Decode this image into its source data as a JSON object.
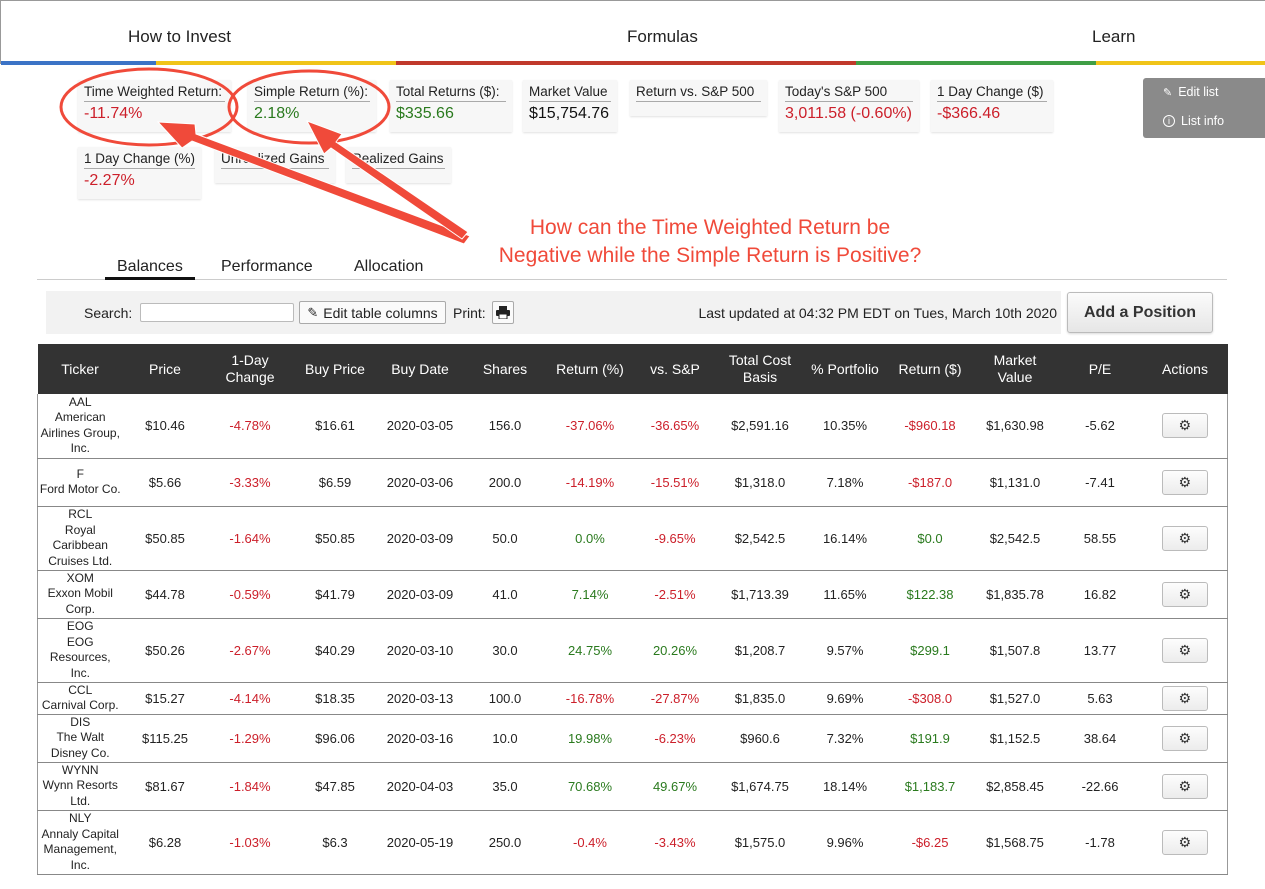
{
  "nav": {
    "items": [
      "How to Invest",
      "Formulas",
      "Learn"
    ],
    "stripe_colors": [
      "#3b73c6",
      "#f0c419",
      "#c0392b",
      "#3f9e45",
      "#f0c419"
    ]
  },
  "stats": [
    {
      "label": "Time Weighted Return:",
      "value": "-11.74%",
      "tone": "neg"
    },
    {
      "label": "Simple Return (%):",
      "value": "2.18%",
      "tone": "pos"
    },
    {
      "label": "Total Returns ($):",
      "value": "$335.66",
      "tone": "pos"
    },
    {
      "label": "Market Value",
      "value": "$15,754.76",
      "tone": "blk"
    },
    {
      "label": "Return vs. S&P 500",
      "value": "",
      "tone": "blk"
    },
    {
      "label": "Today's S&P 500",
      "value": "3,011.58 (-0.60%)",
      "tone": "neg"
    },
    {
      "label": "1 Day Change ($)",
      "value": "-$366.46",
      "tone": "neg"
    },
    {
      "label": "1 Day Change (%)",
      "value": "-2.27%",
      "tone": "neg"
    },
    {
      "label": "Unrealized Gains",
      "value": "",
      "tone": "blk"
    },
    {
      "label": "Realized Gains",
      "value": "",
      "tone": "blk"
    }
  ],
  "sidepanel": {
    "edit_list": "Edit list",
    "list_info": "List info"
  },
  "annotation": {
    "line1": "How can the Time Weighted Return be",
    "line2": "Negative while the Simple Return is Positive?",
    "color": "#f04a3a"
  },
  "tabs": [
    "Balances",
    "Performance",
    "Allocation"
  ],
  "toolbar": {
    "search_label": "Search:",
    "search_value": "",
    "edit_columns_label": "Edit table columns",
    "print_label": "Print:",
    "last_updated": "Last updated at 04:32 PM EDT on Tues, March 10th 2020",
    "add_position_label": "Add a Position"
  },
  "table": {
    "headers": [
      "Ticker",
      "Price",
      "1-Day Change",
      "Buy Price",
      "Buy Date",
      "Shares",
      "Return (%)",
      "vs. S&P",
      "Total Cost Basis",
      "% Portfolio",
      "Return ($)",
      "Market Value",
      "P/E",
      "Actions"
    ],
    "rows": [
      {
        "ticker": "AAL",
        "name": "American Airlines Group, Inc.",
        "price": "$10.46",
        "change": "-4.78%",
        "buy_price": "$16.61",
        "buy_date": "2020-03-05",
        "shares": "156.0",
        "return_pct": "-37.06%",
        "vs_sp": "-36.65%",
        "cost_basis": "$2,591.16",
        "portfolio_pct": "10.35%",
        "return_usd": "-$960.18",
        "market_value": "$1,630.98",
        "pe": "-5.62"
      },
      {
        "ticker": "F",
        "name": "Ford Motor Co.",
        "price": "$5.66",
        "change": "-3.33%",
        "buy_price": "$6.59",
        "buy_date": "2020-03-06",
        "shares": "200.0",
        "return_pct": "-14.19%",
        "vs_sp": "-15.51%",
        "cost_basis": "$1,318.0",
        "portfolio_pct": "7.18%",
        "return_usd": "-$187.0",
        "market_value": "$1,131.0",
        "pe": "-7.41"
      },
      {
        "ticker": "RCL",
        "name": "Royal Caribbean Cruises Ltd.",
        "price": "$50.85",
        "change": "-1.64%",
        "buy_price": "$50.85",
        "buy_date": "2020-03-09",
        "shares": "50.0",
        "return_pct": "0.0%",
        "vs_sp": "-9.65%",
        "cost_basis": "$2,542.5",
        "portfolio_pct": "16.14%",
        "return_usd": "$0.0",
        "market_value": "$2,542.5",
        "pe": "58.55"
      },
      {
        "ticker": "XOM",
        "name": "Exxon Mobil Corp.",
        "price": "$44.78",
        "change": "-0.59%",
        "buy_price": "$41.79",
        "buy_date": "2020-03-09",
        "shares": "41.0",
        "return_pct": "7.14%",
        "vs_sp": "-2.51%",
        "cost_basis": "$1,713.39",
        "portfolio_pct": "11.65%",
        "return_usd": "$122.38",
        "market_value": "$1,835.78",
        "pe": "16.82"
      },
      {
        "ticker": "EOG",
        "name": "EOG Resources, Inc.",
        "price": "$50.26",
        "change": "-2.67%",
        "buy_price": "$40.29",
        "buy_date": "2020-03-10",
        "shares": "30.0",
        "return_pct": "24.75%",
        "vs_sp": "20.26%",
        "cost_basis": "$1,208.7",
        "portfolio_pct": "9.57%",
        "return_usd": "$299.1",
        "market_value": "$1,507.8",
        "pe": "13.77"
      },
      {
        "ticker": "CCL",
        "name": "Carnival Corp.",
        "price": "$15.27",
        "change": "-4.14%",
        "buy_price": "$18.35",
        "buy_date": "2020-03-13",
        "shares": "100.0",
        "return_pct": "-16.78%",
        "vs_sp": "-27.87%",
        "cost_basis": "$1,835.0",
        "portfolio_pct": "9.69%",
        "return_usd": "-$308.0",
        "market_value": "$1,527.0",
        "pe": "5.63"
      },
      {
        "ticker": "DIS",
        "name": "The Walt Disney Co.",
        "price": "$115.25",
        "change": "-1.29%",
        "buy_price": "$96.06",
        "buy_date": "2020-03-16",
        "shares": "10.0",
        "return_pct": "19.98%",
        "vs_sp": "-6.23%",
        "cost_basis": "$960.6",
        "portfolio_pct": "7.32%",
        "return_usd": "$191.9",
        "market_value": "$1,152.5",
        "pe": "38.64"
      },
      {
        "ticker": "WYNN",
        "name": "Wynn Resorts Ltd.",
        "price": "$81.67",
        "change": "-1.84%",
        "buy_price": "$47.85",
        "buy_date": "2020-04-03",
        "shares": "35.0",
        "return_pct": "70.68%",
        "vs_sp": "49.67%",
        "cost_basis": "$1,674.75",
        "portfolio_pct": "18.14%",
        "return_usd": "$1,183.7",
        "market_value": "$2,858.45",
        "pe": "-22.66"
      },
      {
        "ticker": "NLY",
        "name": "Annaly Capital Management, Inc.",
        "price": "$6.28",
        "change": "-1.03%",
        "buy_price": "$6.3",
        "buy_date": "2020-05-19",
        "shares": "250.0",
        "return_pct": "-0.4%",
        "vs_sp": "-3.43%",
        "cost_basis": "$1,575.0",
        "portfolio_pct": "9.96%",
        "return_usd": "-$6.25",
        "market_value": "$1,568.75",
        "pe": "-1.78"
      }
    ]
  }
}
